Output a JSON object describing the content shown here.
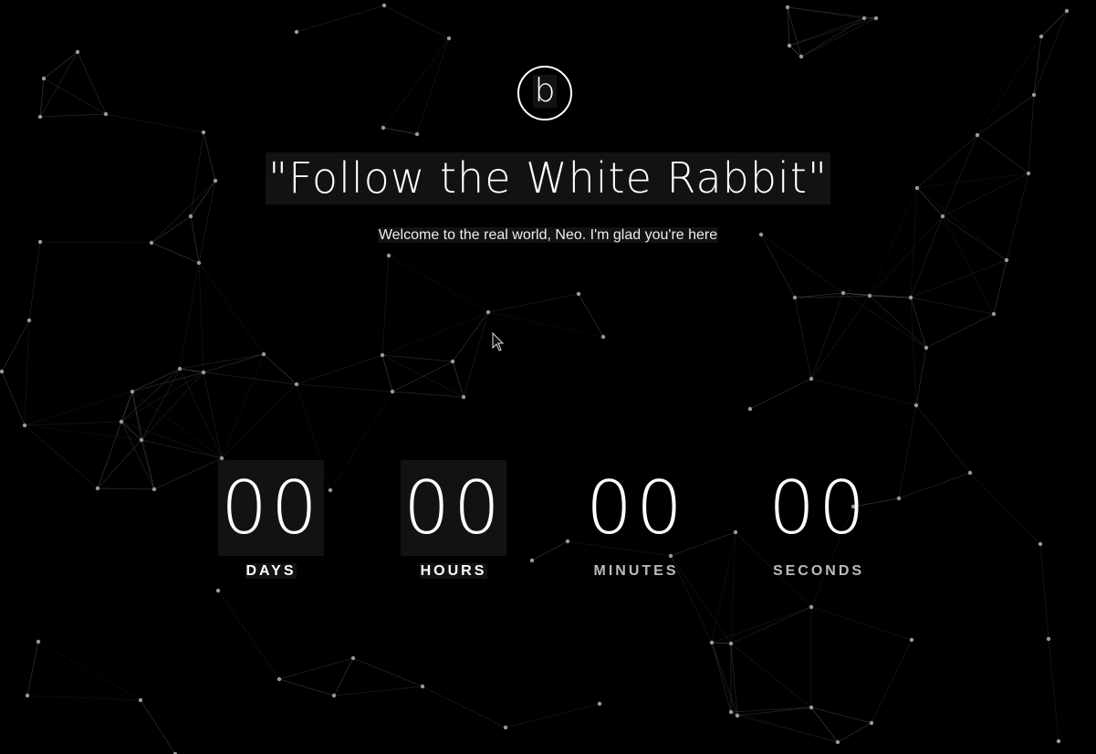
{
  "logo": {
    "letter": "b"
  },
  "title": "\"Follow the White Rabbit\"",
  "subtitle": "Welcome to the real world, Neo. I'm glad you're here",
  "countdown": [
    {
      "value": "00",
      "label": "DAYS"
    },
    {
      "value": "00",
      "label": "HOURS"
    },
    {
      "value": "00",
      "label": "MINUTES"
    },
    {
      "value": "00",
      "label": "SECONDS"
    }
  ],
  "colors": {
    "background": "#000000",
    "text": "#ffffff",
    "highlight": "#111214",
    "network": "#555555"
  }
}
